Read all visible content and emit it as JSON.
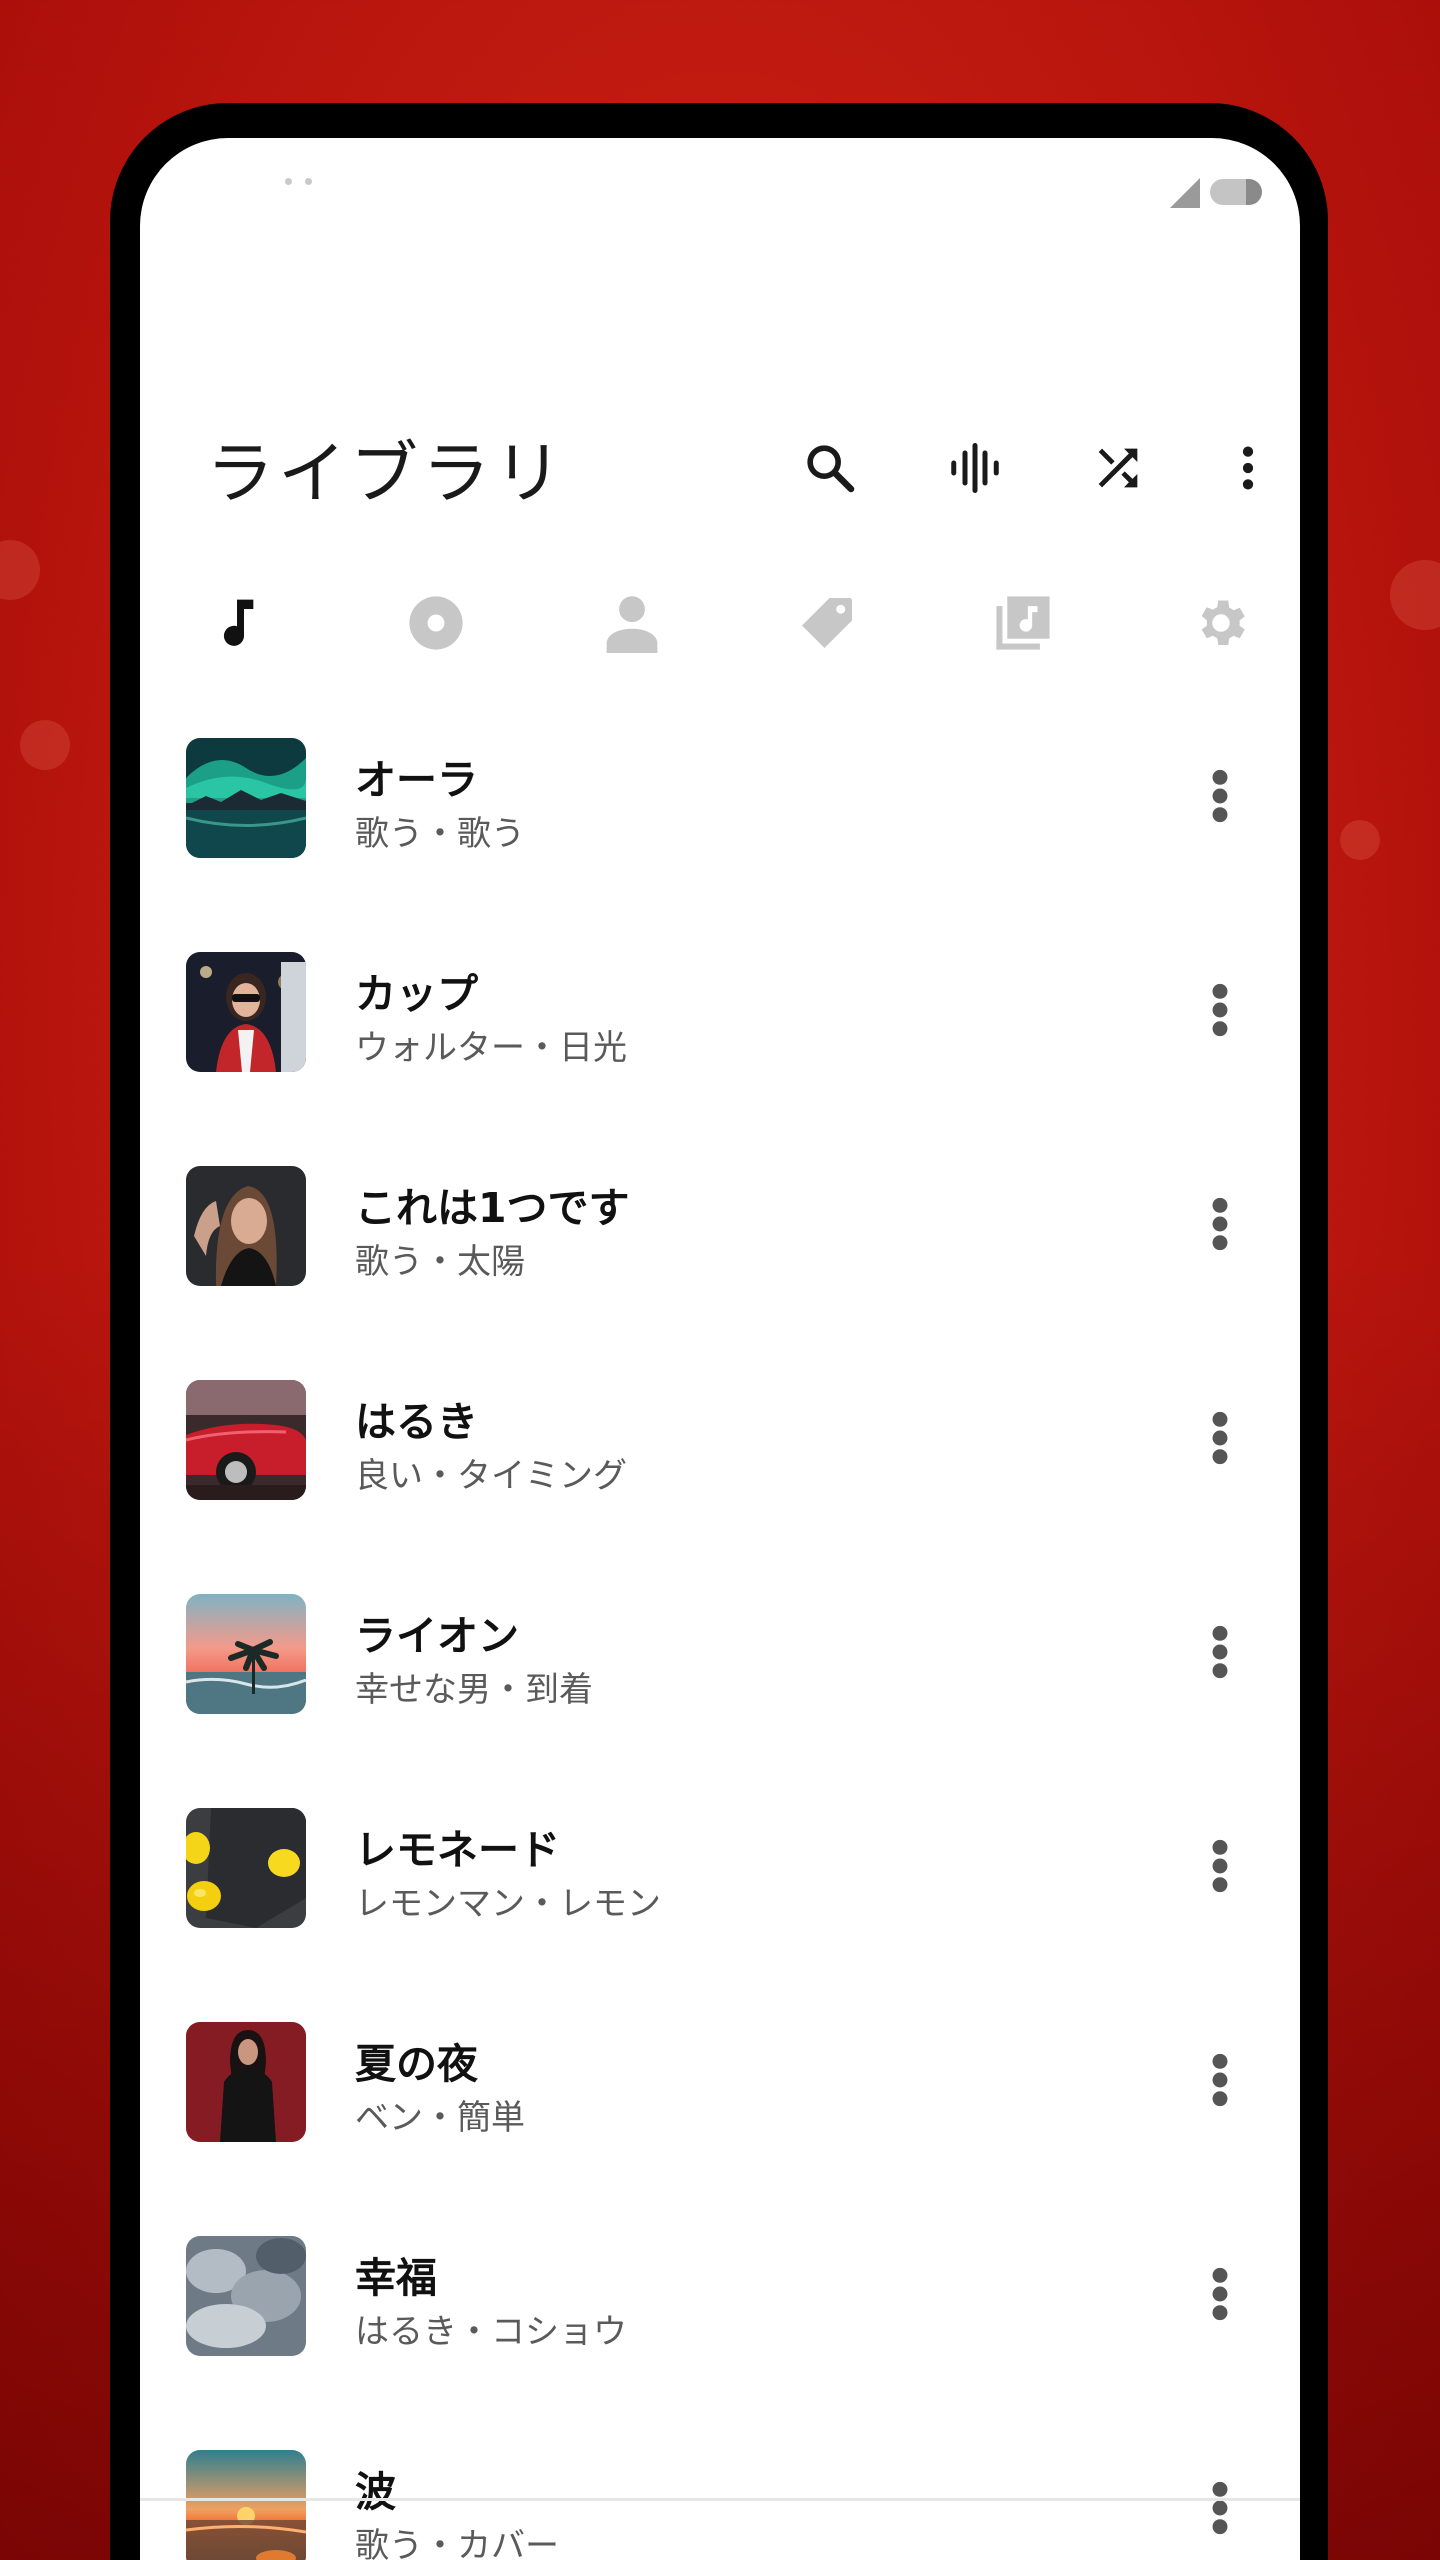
{
  "background": {
    "accent": "#c01a10"
  },
  "status_bar": {
    "icons": [
      "notification-dots-icon",
      "signal-icon",
      "battery-icon"
    ]
  },
  "app_bar": {
    "title": "ライブラリ",
    "actions": [
      {
        "name": "search-icon"
      },
      {
        "name": "equalizer-icon"
      },
      {
        "name": "shuffle-icon"
      },
      {
        "name": "more-vert-icon"
      }
    ]
  },
  "tabs": [
    {
      "name": "songs",
      "icon": "music-note-icon",
      "active": true
    },
    {
      "name": "albums",
      "icon": "album-icon",
      "active": false
    },
    {
      "name": "artists",
      "icon": "person-icon",
      "active": false
    },
    {
      "name": "genres",
      "icon": "tag-icon",
      "active": false
    },
    {
      "name": "playlists",
      "icon": "playlist-icon",
      "active": false
    },
    {
      "name": "settings",
      "icon": "gear-icon",
      "active": false
    }
  ],
  "colors": {
    "tab_active": "#111111",
    "tab_inactive": "#c7c7c7",
    "icon": "#1a1a1a",
    "more_dots": "#555555"
  },
  "songs": [
    {
      "title": "オーラ",
      "subtitle": "歌う・歌う",
      "thumb": "aurora"
    },
    {
      "title": "カップ",
      "subtitle": "ウォルター・日光",
      "thumb": "woman-sunglasses"
    },
    {
      "title": "これは1つです",
      "subtitle": "歌う・太陽",
      "thumb": "woman-portrait"
    },
    {
      "title": "はるき",
      "subtitle": "良い・タイミング",
      "thumb": "red-car"
    },
    {
      "title": "ライオン",
      "subtitle": "幸せな男・到着",
      "thumb": "palm-sunset"
    },
    {
      "title": "レモネード",
      "subtitle": "レモンマン・レモン",
      "thumb": "lemons"
    },
    {
      "title": "夏の夜",
      "subtitle": "ベン・簡単",
      "thumb": "woman-red-wall"
    },
    {
      "title": "幸福",
      "subtitle": "はるき・コショウ",
      "thumb": "clouds"
    },
    {
      "title": "波",
      "subtitle": "歌う・カバー",
      "thumb": "sea-sunset"
    }
  ]
}
